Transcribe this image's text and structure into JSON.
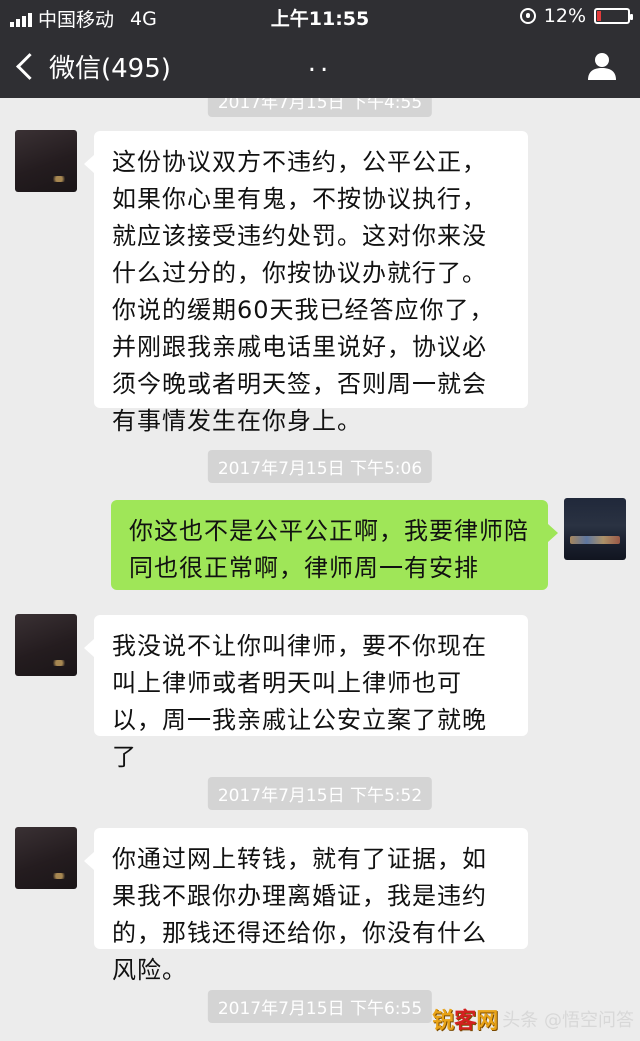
{
  "status_bar": {
    "carrier": "中国移动",
    "network": "4G",
    "time": "上午11:55",
    "battery_percent": "12%",
    "battery_level": 0.12,
    "battery_color": "#e23b3b"
  },
  "nav": {
    "back_label": "微信(495)",
    "title": "..",
    "right_icon": "person-icon"
  },
  "chat": {
    "timestamp_top_partial": "2017年7月15日 下午4:55",
    "messages": [
      {
        "from": "contact",
        "text": "这份协议双方不违约，公平公正，如果你心里有鬼，不按协议执行，就应该接受违约处罚。这对你来没什么过分的，你按协议办就行了。你说的缓期60天我已经答应你了，并刚跟我亲戚电话里说好，协议必须今晚或者明天签，否则周一就会有事情发生在你身上。"
      },
      {
        "timestamp": "2017年7月15日 下午5:06"
      },
      {
        "from": "me",
        "text": "你这也不是公平公正啊，我要律师陪同也很正常啊，律师周一有安排"
      },
      {
        "from": "contact",
        "text": "我没说不让你叫律师，要不你现在叫上律师或者明天叫上律师也可以，周一我亲戚让公安立案了就晚了"
      },
      {
        "timestamp": "2017年7月15日 下午5:52"
      },
      {
        "from": "contact",
        "text": "你通过网上转钱，就有了证据，如果我不跟你办理离婚证，我是违约的，那钱还得还给你，你没有什么风险。"
      },
      {
        "timestamp": "2017年7月15日 下午6:55"
      }
    ]
  },
  "watermark": {
    "brand_part1": "锐",
    "brand_part2": "客",
    "brand_part3": "网",
    "toutiao": "头条 @悟空问答"
  },
  "colors": {
    "bar_bg": "#2f2f33",
    "chat_bg": "#ececec",
    "bubble_in": "#ffffff",
    "bubble_out": "#9fe658"
  }
}
